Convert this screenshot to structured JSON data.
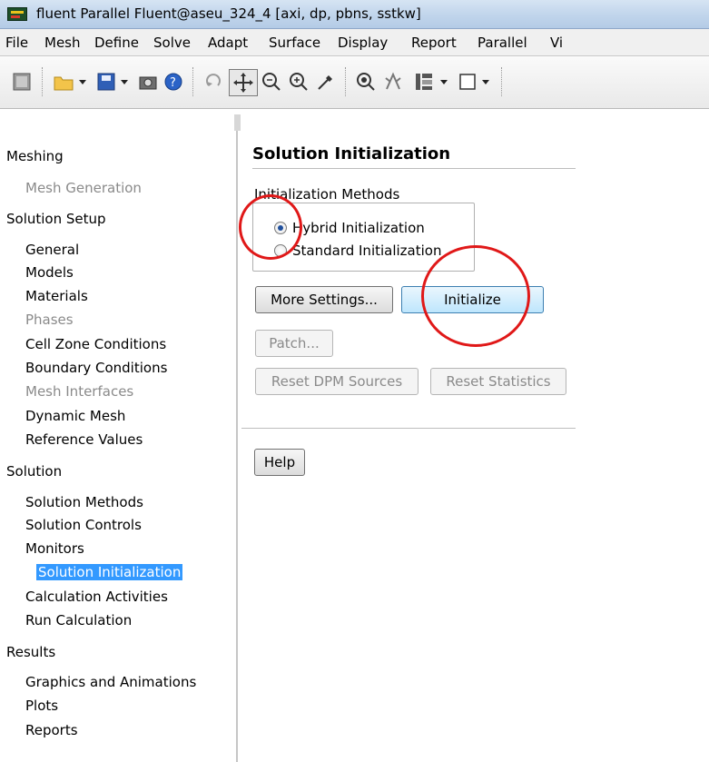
{
  "window": {
    "title": "fluent Parallel Fluent@aseu_324_4  [axi, dp, pbns, sstkw]"
  },
  "menu": [
    "File",
    "Mesh",
    "Define",
    "Solve",
    "Adapt",
    "Surface",
    "Display",
    "Report",
    "Parallel",
    "Vi"
  ],
  "toolbar": {
    "icons": [
      "mesh-icon",
      "open-folder-icon",
      "save-icon",
      "camera-icon",
      "help-icon",
      "rotate-icon",
      "pan-icon",
      "zoom-in-icon",
      "zoom-box-icon",
      "probe-icon",
      "mouse-zoom-icon",
      "mouse-probe-icon",
      "layout-icon",
      "view-box-icon"
    ]
  },
  "tree": {
    "meshing": "Meshing",
    "mesh_generation": "Mesh Generation",
    "solution_setup": "Solution Setup",
    "general": "General",
    "models": "Models",
    "materials": "Materials",
    "phases": "Phases",
    "cell_zone_conditions": "Cell Zone Conditions",
    "boundary_conditions": "Boundary Conditions",
    "mesh_interfaces": "Mesh Interfaces",
    "dynamic_mesh": "Dynamic Mesh",
    "reference_values": "Reference Values",
    "solution": "Solution",
    "solution_methods": "Solution Methods",
    "solution_controls": "Solution Controls",
    "monitors": "Monitors",
    "solution_initialization": "Solution Initialization",
    "calculation_activities": "Calculation Activities",
    "run_calculation": "Run Calculation",
    "results": "Results",
    "graphics_and_animations": "Graphics and Animations",
    "plots": "Plots",
    "reports": "Reports"
  },
  "panel": {
    "title": "Solution Initialization",
    "methods_label": "Initialization Methods",
    "hybrid": "Hybrid  Initialization",
    "standard": "Standard Initialization",
    "selected_method": "Hybrid  Initialization",
    "more_settings": "More Settings...",
    "initialize": "Initialize",
    "patch": "Patch...",
    "reset_dpm": "Reset DPM Sources",
    "reset_stats": "Reset Statistics",
    "help": "Help"
  },
  "colors": {
    "selection": "#3399ff",
    "annotation": "#e01818",
    "primary_button": "#bee6fd"
  }
}
